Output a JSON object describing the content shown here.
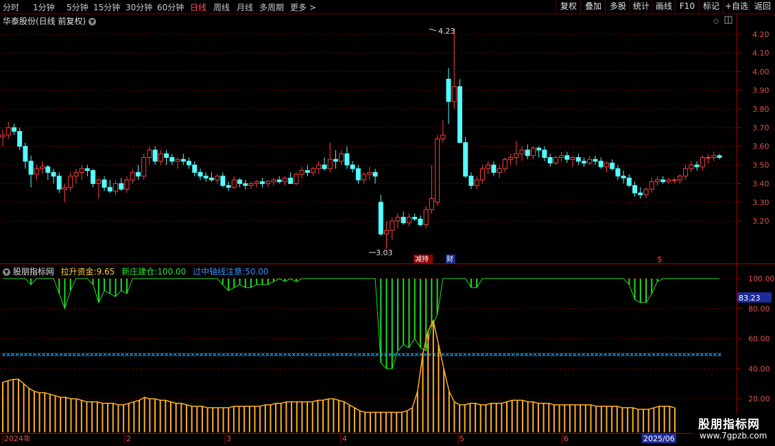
{
  "toolbar": {
    "timeframes": [
      "分时",
      "1分钟",
      "5分钟",
      "15分钟",
      "30分钟",
      "60分钟",
      "日线",
      "周线",
      "月线",
      "多周期",
      "更多"
    ],
    "active": "日线",
    "right_buttons": [
      "复权",
      "叠加",
      "多股",
      "统计",
      "画线",
      "F10",
      "标记",
      "+自选",
      "返回"
    ]
  },
  "main_title": "华泰股份(日线 前复权)",
  "indicator": {
    "name": "股朋指标网",
    "label1": "拉升资金:",
    "value1": "9.65",
    "label2": "新庄建仓:",
    "value2": "100.00",
    "label3": "过中轴线注意:",
    "value3": "50.00",
    "current_value": "83.23"
  },
  "annotations": {
    "high": "4.23",
    "low": "3.03",
    "events": [
      "减持",
      "财"
    ],
    "dollar": "$"
  },
  "x_labels": [
    "2024年",
    "2",
    "3",
    "4",
    "5",
    "6",
    "2025/06"
  ],
  "logo": {
    "line1": "股朋指标网",
    "line2": "www.7gpzb.com"
  },
  "colors": {
    "up": "#ff4040",
    "down": "#54ffff",
    "bar": "#ffb020",
    "line": "#22dd22",
    "cross": "#2aa0e8"
  },
  "chart_data": [
    {
      "type": "candlestick",
      "ylim": [
        3.05,
        4.25
      ],
      "yticks": [
        3.2,
        3.3,
        3.4,
        3.5,
        3.6,
        3.7,
        3.8,
        3.9,
        4.0,
        4.1,
        4.2
      ],
      "ohlc": [
        [
          3.65,
          3.69,
          3.6,
          3.66
        ],
        [
          3.66,
          3.73,
          3.64,
          3.7
        ],
        [
          3.7,
          3.72,
          3.66,
          3.68
        ],
        [
          3.68,
          3.7,
          3.58,
          3.6
        ],
        [
          3.6,
          3.62,
          3.48,
          3.52
        ],
        [
          3.52,
          3.55,
          3.38,
          3.45
        ],
        [
          3.45,
          3.5,
          3.42,
          3.48
        ],
        [
          3.48,
          3.52,
          3.45,
          3.49
        ],
        [
          3.49,
          3.5,
          3.42,
          3.46
        ],
        [
          3.46,
          3.48,
          3.4,
          3.44
        ],
        [
          3.44,
          3.46,
          3.35,
          3.37
        ],
        [
          3.37,
          3.4,
          3.3,
          3.38
        ],
        [
          3.38,
          3.46,
          3.36,
          3.44
        ],
        [
          3.44,
          3.48,
          3.4,
          3.46
        ],
        [
          3.46,
          3.5,
          3.42,
          3.48
        ],
        [
          3.48,
          3.5,
          3.44,
          3.47
        ],
        [
          3.47,
          3.48,
          3.38,
          3.4
        ],
        [
          3.4,
          3.43,
          3.32,
          3.42
        ],
        [
          3.42,
          3.44,
          3.36,
          3.38
        ],
        [
          3.38,
          3.42,
          3.35,
          3.36
        ],
        [
          3.36,
          3.42,
          3.34,
          3.4
        ],
        [
          3.4,
          3.43,
          3.36,
          3.37
        ],
        [
          3.37,
          3.44,
          3.35,
          3.42
        ],
        [
          3.42,
          3.48,
          3.4,
          3.46
        ],
        [
          3.46,
          3.5,
          3.42,
          3.44
        ],
        [
          3.44,
          3.56,
          3.42,
          3.54
        ],
        [
          3.54,
          3.6,
          3.5,
          3.58
        ],
        [
          3.58,
          3.6,
          3.5,
          3.52
        ],
        [
          3.52,
          3.58,
          3.5,
          3.56
        ],
        [
          3.56,
          3.58,
          3.5,
          3.54
        ],
        [
          3.54,
          3.56,
          3.5,
          3.52
        ],
        [
          3.52,
          3.54,
          3.48,
          3.53
        ],
        [
          3.53,
          3.56,
          3.5,
          3.52
        ],
        [
          3.52,
          3.54,
          3.48,
          3.5
        ],
        [
          3.5,
          3.52,
          3.44,
          3.46
        ],
        [
          3.46,
          3.48,
          3.42,
          3.44
        ],
        [
          3.44,
          3.46,
          3.41,
          3.43
        ],
        [
          3.43,
          3.46,
          3.41,
          3.42
        ],
        [
          3.42,
          3.45,
          3.4,
          3.44
        ],
        [
          3.44,
          3.46,
          3.38,
          3.39
        ],
        [
          3.39,
          3.41,
          3.36,
          3.38
        ],
        [
          3.38,
          3.44,
          3.37,
          3.42
        ],
        [
          3.42,
          3.43,
          3.38,
          3.4
        ],
        [
          3.4,
          3.42,
          3.37,
          3.39
        ],
        [
          3.39,
          3.41,
          3.37,
          3.4
        ],
        [
          3.4,
          3.42,
          3.38,
          3.41
        ],
        [
          3.41,
          3.43,
          3.38,
          3.4
        ],
        [
          3.4,
          3.42,
          3.38,
          3.41
        ],
        [
          3.41,
          3.43,
          3.39,
          3.42
        ],
        [
          3.42,
          3.44,
          3.4,
          3.41
        ],
        [
          3.41,
          3.44,
          3.39,
          3.43
        ],
        [
          3.43,
          3.46,
          3.4,
          3.4
        ],
        [
          3.4,
          3.46,
          3.39,
          3.45
        ],
        [
          3.45,
          3.49,
          3.43,
          3.47
        ],
        [
          3.47,
          3.5,
          3.44,
          3.46
        ],
        [
          3.46,
          3.49,
          3.44,
          3.48
        ],
        [
          3.48,
          3.52,
          3.45,
          3.5
        ],
        [
          3.5,
          3.54,
          3.47,
          3.48
        ],
        [
          3.48,
          3.62,
          3.46,
          3.53
        ],
        [
          3.53,
          3.58,
          3.48,
          3.52
        ],
        [
          3.52,
          3.58,
          3.5,
          3.56
        ],
        [
          3.56,
          3.6,
          3.48,
          3.5
        ],
        [
          3.5,
          3.52,
          3.46,
          3.48
        ],
        [
          3.48,
          3.5,
          3.4,
          3.42
        ],
        [
          3.42,
          3.46,
          3.4,
          3.45
        ],
        [
          3.45,
          3.49,
          3.42,
          3.46
        ],
        [
          3.46,
          3.48,
          3.4,
          3.44
        ],
        [
          3.3,
          3.34,
          3.12,
          3.13
        ],
        [
          3.13,
          3.2,
          3.05,
          3.15
        ],
        [
          3.15,
          3.22,
          3.1,
          3.2
        ],
        [
          3.2,
          3.24,
          3.16,
          3.22
        ],
        [
          3.22,
          3.25,
          3.18,
          3.19
        ],
        [
          3.19,
          3.24,
          3.17,
          3.22
        ],
        [
          3.22,
          3.24,
          3.2,
          3.21
        ],
        [
          3.21,
          3.23,
          3.17,
          3.18
        ],
        [
          3.18,
          3.28,
          3.16,
          3.26
        ],
        [
          3.26,
          3.5,
          3.24,
          3.32
        ],
        [
          3.3,
          3.66,
          3.28,
          3.64
        ],
        [
          3.64,
          3.74,
          3.62,
          3.66
        ],
        [
          3.96,
          4.02,
          3.72,
          3.84
        ],
        [
          3.84,
          4.23,
          3.8,
          3.92
        ],
        [
          3.92,
          3.96,
          3.62,
          3.62
        ],
        [
          3.62,
          3.65,
          3.43,
          3.44
        ],
        [
          3.44,
          3.46,
          3.37,
          3.39
        ],
        [
          3.39,
          3.44,
          3.37,
          3.42
        ],
        [
          3.42,
          3.5,
          3.4,
          3.48
        ],
        [
          3.48,
          3.52,
          3.45,
          3.5
        ],
        [
          3.5,
          3.52,
          3.44,
          3.46
        ],
        [
          3.46,
          3.5,
          3.43,
          3.48
        ],
        [
          3.48,
          3.54,
          3.46,
          3.53
        ],
        [
          3.53,
          3.56,
          3.5,
          3.54
        ],
        [
          3.54,
          3.63,
          3.5,
          3.56
        ],
        [
          3.56,
          3.6,
          3.52,
          3.58
        ],
        [
          3.58,
          3.61,
          3.53,
          3.55
        ],
        [
          3.55,
          3.6,
          3.53,
          3.59
        ],
        [
          3.59,
          3.6,
          3.54,
          3.58
        ],
        [
          3.58,
          3.6,
          3.52,
          3.54
        ],
        [
          3.54,
          3.56,
          3.49,
          3.51
        ],
        [
          3.51,
          3.55,
          3.5,
          3.54
        ],
        [
          3.54,
          3.57,
          3.52,
          3.55
        ],
        [
          3.55,
          3.57,
          3.51,
          3.53
        ],
        [
          3.53,
          3.55,
          3.49,
          3.54
        ],
        [
          3.54,
          3.56,
          3.5,
          3.52
        ],
        [
          3.52,
          3.54,
          3.49,
          3.51
        ],
        [
          3.51,
          3.55,
          3.5,
          3.53
        ],
        [
          3.53,
          3.55,
          3.5,
          3.52
        ],
        [
          3.52,
          3.54,
          3.48,
          3.49
        ],
        [
          3.49,
          3.52,
          3.46,
          3.51
        ],
        [
          3.51,
          3.53,
          3.47,
          3.48
        ],
        [
          3.48,
          3.5,
          3.42,
          3.44
        ],
        [
          3.44,
          3.47,
          3.4,
          3.43
        ],
        [
          3.43,
          3.45,
          3.38,
          3.39
        ],
        [
          3.39,
          3.41,
          3.33,
          3.35
        ],
        [
          3.35,
          3.38,
          3.32,
          3.34
        ],
        [
          3.34,
          3.38,
          3.32,
          3.37
        ],
        [
          3.37,
          3.43,
          3.35,
          3.41
        ],
        [
          3.41,
          3.44,
          3.39,
          3.42
        ],
        [
          3.42,
          3.44,
          3.4,
          3.41
        ],
        [
          3.41,
          3.43,
          3.4,
          3.42
        ],
        [
          3.42,
          3.43,
          3.4,
          3.42
        ],
        [
          3.42,
          3.45,
          3.4,
          3.44
        ],
        [
          3.44,
          3.5,
          3.42,
          3.48
        ],
        [
          3.48,
          3.52,
          3.46,
          3.5
        ],
        [
          3.5,
          3.52,
          3.47,
          3.49
        ],
        [
          3.49,
          3.55,
          3.47,
          3.54
        ],
        [
          3.54,
          3.56,
          3.51,
          3.54
        ],
        [
          3.54,
          3.57,
          3.52,
          3.55
        ],
        [
          3.55,
          3.56,
          3.53,
          3.54
        ]
      ]
    },
    {
      "type": "bar",
      "series_name": "拉升资金",
      "ylim": [
        10,
        110
      ],
      "yticks": [
        20,
        40,
        60,
        80,
        100
      ],
      "values": [
        31,
        32,
        33,
        33,
        30,
        27,
        25,
        24,
        24,
        23,
        22,
        21,
        21,
        20,
        20,
        19,
        18,
        18,
        18,
        17,
        17,
        17,
        16,
        16,
        17,
        18,
        19,
        21,
        20,
        20,
        19,
        19,
        18,
        17,
        17,
        16,
        15,
        15,
        15,
        14,
        14,
        14,
        14,
        14,
        15,
        15,
        15,
        15,
        15,
        15,
        16,
        16,
        17,
        17,
        18,
        18,
        18,
        18,
        18,
        18,
        19,
        19,
        20,
        20,
        19,
        18,
        16,
        14,
        12,
        11,
        11,
        11,
        11,
        11,
        11,
        11,
        11,
        12,
        14,
        25,
        50,
        65,
        72,
        56,
        40,
        25,
        18,
        16,
        16,
        17,
        17,
        16,
        16,
        17,
        17,
        17,
        18,
        19,
        19,
        19,
        18,
        18,
        17,
        17,
        17,
        16,
        16,
        16,
        16,
        16,
        16,
        16,
        16,
        15,
        15,
        15,
        15,
        15,
        14,
        14,
        14,
        13,
        13,
        13,
        14,
        15,
        15,
        15,
        14
      ]
    }
  ]
}
